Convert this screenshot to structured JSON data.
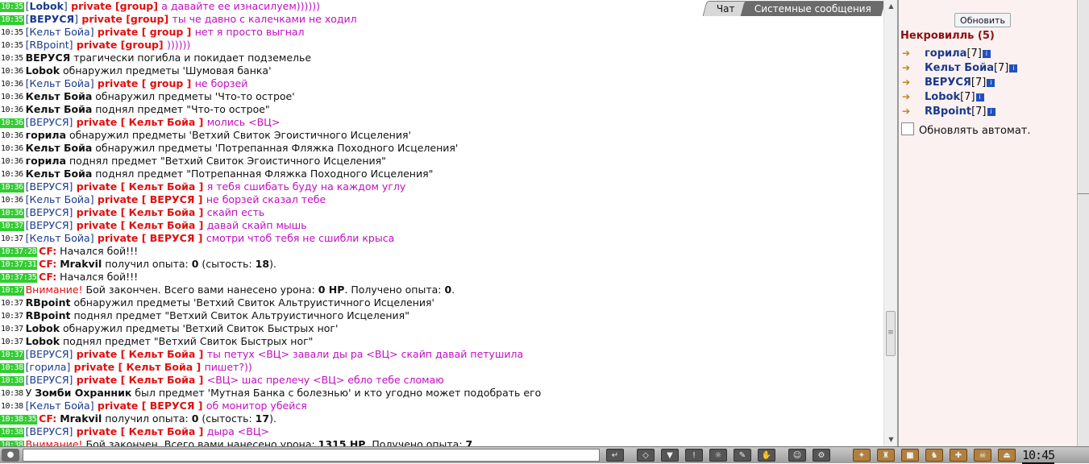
{
  "tabs": [
    {
      "label": "Чат",
      "active": false
    },
    {
      "label": "Системные сообщения",
      "active": true
    }
  ],
  "chat": {
    "lines": [
      {
        "ts": "10:35",
        "tsg": true,
        "parts": [
          [
            "b",
            "[",
            "nick"
          ],
          [
            "n",
            "Lobok",
            "nickb"
          ],
          [
            "b",
            "]",
            "nick"
          ],
          [
            "p",
            " private [group] ",
            "priv"
          ],
          [
            "m",
            "а давайте ее изнасилуем))))))",
            "pm"
          ]
        ]
      },
      {
        "ts": "10:35",
        "tsg": true,
        "parts": [
          [
            "b",
            "[",
            "nick"
          ],
          [
            "n",
            "ВЕРУСЯ",
            "nickb"
          ],
          [
            "b",
            "]",
            "nick"
          ],
          [
            "p",
            " private [group] ",
            "priv"
          ],
          [
            "m",
            "ты че давно с калечками не ходил",
            "pm"
          ]
        ]
      },
      {
        "ts": "10:35",
        "tsg": false,
        "parts": [
          [
            "b",
            "[",
            "nick"
          ],
          [
            "n",
            "Кельт Бойа",
            "nick"
          ],
          [
            "b",
            "]",
            "nick"
          ],
          [
            "p",
            " private [ group ] ",
            "priv"
          ],
          [
            "m",
            "нет я просто выгнал",
            "pm"
          ]
        ]
      },
      {
        "ts": "10:35",
        "tsg": false,
        "parts": [
          [
            "b",
            "[",
            "nick"
          ],
          [
            "n",
            "RBpoint",
            "nick"
          ],
          [
            "b",
            "]",
            "nick"
          ],
          [
            "p",
            " private [group] ",
            "priv"
          ],
          [
            "m",
            "))))))",
            "pm"
          ]
        ]
      },
      {
        "ts": "10:35",
        "tsg": false,
        "parts": [
          [
            "w",
            "ВЕРУСЯ",
            "who"
          ],
          [
            "t",
            " трагически погибла и покидает подземелье",
            ""
          ]
        ]
      },
      {
        "ts": "10:36",
        "tsg": false,
        "parts": [
          [
            "w",
            "Lobok",
            "who"
          ],
          [
            "t",
            " обнаружил предметы 'Шумовая банка'",
            ""
          ]
        ]
      },
      {
        "ts": "10:36",
        "tsg": false,
        "parts": [
          [
            "b",
            "[",
            "nick"
          ],
          [
            "n",
            "Кельт Бойа",
            "nick"
          ],
          [
            "b",
            "]",
            "nick"
          ],
          [
            "p",
            " private [ group ] ",
            "priv"
          ],
          [
            "m",
            "не борзей",
            "pm"
          ]
        ]
      },
      {
        "ts": "10:36",
        "tsg": false,
        "parts": [
          [
            "w",
            "Кельт Бойа",
            "who"
          ],
          [
            "t",
            " обнаружил предметы 'Что-то острое'",
            ""
          ]
        ]
      },
      {
        "ts": "10:36",
        "tsg": false,
        "parts": [
          [
            "w",
            "Кельт Бойа",
            "who"
          ],
          [
            "t",
            " поднял предмет \"Что-то острое\"",
            ""
          ]
        ]
      },
      {
        "ts": "10:36",
        "tsg": true,
        "parts": [
          [
            "b",
            "[",
            "nick"
          ],
          [
            "n",
            "ВЕРУСЯ",
            "nick"
          ],
          [
            "b",
            "]",
            "nick"
          ],
          [
            "p",
            " private [ Кельт Бойа ] ",
            "priv"
          ],
          [
            "m",
            "молись <ВЦ>",
            "pm"
          ]
        ]
      },
      {
        "ts": "10:36",
        "tsg": false,
        "parts": [
          [
            "w",
            "горила",
            "who"
          ],
          [
            "t",
            " обнаружил предметы 'Ветхий Свиток Эгоистичного Исцеления'",
            ""
          ]
        ]
      },
      {
        "ts": "10:36",
        "tsg": false,
        "parts": [
          [
            "w",
            "Кельт Бойа",
            "who"
          ],
          [
            "t",
            " обнаружил предметы 'Потрепанная Фляжка Походного Исцеления'",
            ""
          ]
        ]
      },
      {
        "ts": "10:36",
        "tsg": false,
        "parts": [
          [
            "w",
            "горила",
            "who"
          ],
          [
            "t",
            " поднял предмет \"Ветхий Свиток Эгоистичного Исцеления\"",
            ""
          ]
        ]
      },
      {
        "ts": "10:36",
        "tsg": false,
        "parts": [
          [
            "w",
            "Кельт Бойа",
            "who"
          ],
          [
            "t",
            " поднял предмет \"Потрепанная Фляжка Походного Исцеления\"",
            ""
          ]
        ]
      },
      {
        "ts": "10:36",
        "tsg": true,
        "parts": [
          [
            "b",
            "[",
            "nick"
          ],
          [
            "n",
            "ВЕРУСЯ",
            "nick"
          ],
          [
            "b",
            "]",
            "nick"
          ],
          [
            "p",
            " private [ Кельт Бойа ] ",
            "priv"
          ],
          [
            "m",
            "я тебя сшибать буду на каждом углу",
            "pm"
          ]
        ]
      },
      {
        "ts": "10:36",
        "tsg": false,
        "parts": [
          [
            "b",
            "[",
            "nick"
          ],
          [
            "n",
            "Кельт Бойа",
            "nick"
          ],
          [
            "b",
            "]",
            "nick"
          ],
          [
            "p",
            " private [ ВЕРУСЯ ] ",
            "priv"
          ],
          [
            "m",
            "не борзей сказал тебе",
            "pm"
          ]
        ]
      },
      {
        "ts": "10:36",
        "tsg": true,
        "parts": [
          [
            "b",
            "[",
            "nick"
          ],
          [
            "n",
            "ВЕРУСЯ",
            "nick"
          ],
          [
            "b",
            "]",
            "nick"
          ],
          [
            "p",
            " private [ Кельт Бойа ] ",
            "priv"
          ],
          [
            "m",
            "скайп есть",
            "pm"
          ]
        ]
      },
      {
        "ts": "10:37",
        "tsg": true,
        "parts": [
          [
            "b",
            "[",
            "nick"
          ],
          [
            "n",
            "ВЕРУСЯ",
            "nick"
          ],
          [
            "b",
            "]",
            "nick"
          ],
          [
            "p",
            " private [ Кельт Бойа ] ",
            "priv"
          ],
          [
            "m",
            "давай скайп мышь",
            "pm"
          ]
        ]
      },
      {
        "ts": "10:37",
        "tsg": false,
        "parts": [
          [
            "b",
            "[",
            "nick"
          ],
          [
            "n",
            "Кельт Бойа",
            "nick"
          ],
          [
            "b",
            "]",
            "nick"
          ],
          [
            "p",
            " private [ ВЕРУСЯ ] ",
            "priv"
          ],
          [
            "m",
            "смотри чтоб тебя не сшибли крыса",
            "pm"
          ]
        ]
      },
      {
        "ts": "10:37:28",
        "tsg": true,
        "parts": [
          [
            "c",
            "CF:",
            "cf"
          ],
          [
            "t",
            " Начался бой!!!",
            ""
          ]
        ]
      },
      {
        "ts": "10:37:31",
        "tsg": true,
        "parts": [
          [
            "c",
            "CF:",
            "cf"
          ],
          [
            "t",
            " ",
            ""
          ],
          [
            "w",
            "Mrakvil",
            "who"
          ],
          [
            "t",
            " получил опыта: ",
            ""
          ],
          [
            "x",
            "0",
            "bold"
          ],
          [
            "t",
            " (сытость: ",
            ""
          ],
          [
            "x",
            "18",
            "bold"
          ],
          [
            "t",
            "). ",
            ""
          ]
        ]
      },
      {
        "ts": "10:37:35",
        "tsg": true,
        "parts": [
          [
            "c",
            "CF:",
            "cf"
          ],
          [
            "t",
            " Начался бой!!!",
            ""
          ]
        ]
      },
      {
        "ts": "10:37",
        "tsg": true,
        "parts": [
          [
            "v",
            "Внимание!",
            "warn"
          ],
          [
            "t",
            " Бой закончен. Всего вами нанесено урона: ",
            ""
          ],
          [
            "x",
            "0 HP",
            "bold"
          ],
          [
            "t",
            ". Получено опыта: ",
            ""
          ],
          [
            "x",
            "0",
            "bold"
          ],
          [
            "t",
            ".",
            ""
          ]
        ]
      },
      {
        "ts": "10:37",
        "tsg": false,
        "parts": [
          [
            "w",
            "RBpoint",
            "who"
          ],
          [
            "t",
            " обнаружил предметы 'Ветхий Свиток Альтруистичного Исцеления'",
            ""
          ]
        ]
      },
      {
        "ts": "10:37",
        "tsg": false,
        "parts": [
          [
            "w",
            "RBpoint",
            "who"
          ],
          [
            "t",
            " поднял предмет \"Ветхий Свиток Альтруистичного Исцеления\"",
            ""
          ]
        ]
      },
      {
        "ts": "10:37",
        "tsg": false,
        "parts": [
          [
            "w",
            "Lobok",
            "who"
          ],
          [
            "t",
            " обнаружил предметы 'Ветхий Свиток Быстрых ног'",
            ""
          ]
        ]
      },
      {
        "ts": "10:37",
        "tsg": false,
        "parts": [
          [
            "w",
            "Lobok",
            "who"
          ],
          [
            "t",
            " поднял предмет \"Ветхий Свиток Быстрых ног\"",
            ""
          ]
        ]
      },
      {
        "ts": "10:37",
        "tsg": true,
        "parts": [
          [
            "b",
            "[",
            "nick"
          ],
          [
            "n",
            "ВЕРУСЯ",
            "nick"
          ],
          [
            "b",
            "]",
            "nick"
          ],
          [
            "p",
            " private [ Кельт Бойа ] ",
            "priv"
          ],
          [
            "m",
            "ты петух <ВЦ> завали ды ра <ВЦ> скайп давай петушила",
            "pm"
          ]
        ]
      },
      {
        "ts": "10:38",
        "tsg": true,
        "parts": [
          [
            "b",
            "[",
            "nick"
          ],
          [
            "n",
            "горила",
            "nick"
          ],
          [
            "b",
            "]",
            "nick"
          ],
          [
            "p",
            " private [ Кельт Бойа ] ",
            "priv"
          ],
          [
            "m",
            "пишет?))",
            "pm"
          ]
        ]
      },
      {
        "ts": "10:38",
        "tsg": true,
        "parts": [
          [
            "b",
            "[",
            "nick"
          ],
          [
            "n",
            "ВЕРУСЯ",
            "nick"
          ],
          [
            "b",
            "]",
            "nick"
          ],
          [
            "p",
            " private [ Кельт Бойа ] ",
            "priv"
          ],
          [
            "m",
            "<ВЦ> шас прелечу <ВЦ> ебло тебе сломаю",
            "pm"
          ]
        ]
      },
      {
        "ts": "10:38",
        "tsg": false,
        "parts": [
          [
            "t",
            "У ",
            ""
          ],
          [
            "w",
            "Зомби Охранник",
            "who"
          ],
          [
            "t",
            " был предмет 'Мутная Банка с болезнью' и кто угодно может подобрать его",
            ""
          ]
        ]
      },
      {
        "ts": "10:38",
        "tsg": false,
        "parts": [
          [
            "b",
            "[",
            "nick"
          ],
          [
            "n",
            "Кельт Бойа",
            "nick"
          ],
          [
            "b",
            "]",
            "nick"
          ],
          [
            "p",
            " private [ ВЕРУСЯ ] ",
            "priv"
          ],
          [
            "m",
            "об монитор убейся",
            "pm"
          ]
        ]
      },
      {
        "ts": "10:38:35",
        "tsg": true,
        "parts": [
          [
            "c",
            "CF:",
            "cf"
          ],
          [
            "t",
            " ",
            ""
          ],
          [
            "w",
            "Mrakvil",
            "who"
          ],
          [
            "t",
            " получил опыта: ",
            ""
          ],
          [
            "x",
            "0",
            "bold"
          ],
          [
            "t",
            " (сытость: ",
            ""
          ],
          [
            "x",
            "17",
            "bold"
          ],
          [
            "t",
            "). ",
            ""
          ]
        ]
      },
      {
        "ts": "10:38",
        "tsg": true,
        "parts": [
          [
            "b",
            "[",
            "nick"
          ],
          [
            "n",
            "ВЕРУСЯ",
            "nick"
          ],
          [
            "b",
            "]",
            "nick"
          ],
          [
            "p",
            " private [ Кельт Бойа ] ",
            "priv"
          ],
          [
            "m",
            "дыра <ВЦ>",
            "pm"
          ]
        ]
      },
      {
        "ts": "10:38",
        "tsg": true,
        "parts": [
          [
            "v",
            "Внимание!",
            "warn"
          ],
          [
            "t",
            " Бой закончен. Всего вами нанесено урона: ",
            ""
          ],
          [
            "x",
            "1315 HP",
            "bold"
          ],
          [
            "t",
            ". Получено опыта: ",
            ""
          ],
          [
            "x",
            "7",
            "bold"
          ]
        ]
      }
    ]
  },
  "sidebar": {
    "refresh_label": "Обновить",
    "location": "Некровилль (5)",
    "members": [
      {
        "name": "горила",
        "level": "[7]"
      },
      {
        "name": "Кельт Бойа",
        "level": "[7]"
      },
      {
        "name": "ВЕРУСЯ",
        "level": "[7]"
      },
      {
        "name": "Lobok",
        "level": "[7]"
      },
      {
        "name": "RBpoint",
        "level": "[7]"
      }
    ],
    "auto_label": "Обновлять автомат."
  },
  "toolbar": {
    "clock": "10:45",
    "message_value": ""
  },
  "icons": {
    "info": "i",
    "arrow": "➔"
  },
  "colors": {
    "timestamp_bg": "#33cc33",
    "private": "#e01010",
    "pm_text": "#c010c0",
    "nick": "#1a3a8c",
    "location": "#8b1010"
  }
}
